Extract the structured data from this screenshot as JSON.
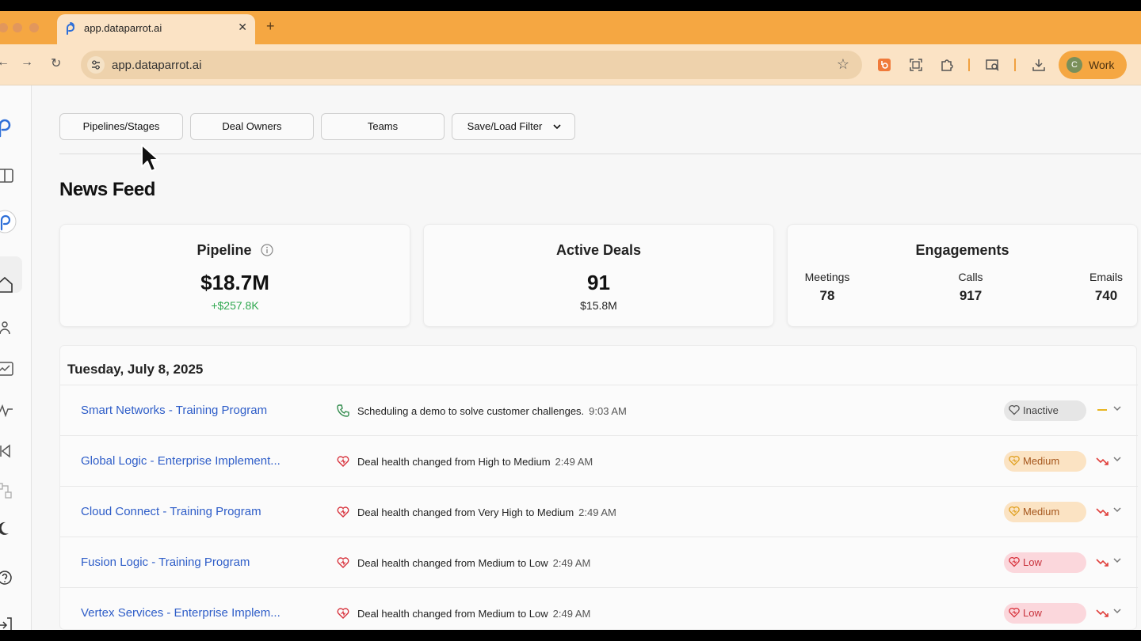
{
  "browser": {
    "tab_title": "app.dataparrot.ai",
    "close_glyph": "✕",
    "newtab_glyph": "+",
    "url": "app.dataparrot.ai",
    "profile_initial": "C",
    "profile_label": "Work",
    "back_glyph": "←",
    "forward_glyph": "→",
    "reload_glyph": "↻",
    "star_glyph": "☆"
  },
  "filters": {
    "pipelines": "Pipelines/Stages",
    "owners": "Deal Owners",
    "teams": "Teams",
    "save_load": "Save/Load Filter"
  },
  "page": {
    "title": "News Feed"
  },
  "cards": {
    "pipeline": {
      "title": "Pipeline",
      "value": "$18.7M",
      "change": "+$257.8K",
      "change_color": "#2fa84f"
    },
    "active_deals": {
      "title": "Active Deals",
      "value": "91",
      "amount": "$15.8M"
    },
    "engagements": {
      "title": "Engagements",
      "meetings_label": "Meetings",
      "meetings": "78",
      "calls_label": "Calls",
      "calls": "917",
      "emails_label": "Emails",
      "emails": "740"
    }
  },
  "feed": {
    "date": "Tuesday, July 8, 2025",
    "rows": [
      {
        "deal": "Smart Networks - Training Program",
        "icon": "phone-icon",
        "message": "Scheduling a demo to solve customer challenges.",
        "time": "9:03 AM",
        "health": "Inactive",
        "trend": "flat-icon"
      },
      {
        "deal": "Global Logic - Enterprise Implement...",
        "icon": "heart-pulse-icon",
        "message": "Deal health changed from High to Medium",
        "time": "2:49 AM",
        "health": "Medium",
        "trend": "trending-down-icon"
      },
      {
        "deal": "Cloud Connect - Training Program",
        "icon": "heart-pulse-icon",
        "message": "Deal health changed from Very High to Medium",
        "time": "2:49 AM",
        "health": "Medium",
        "trend": "trending-down-icon"
      },
      {
        "deal": "Fusion Logic - Training Program",
        "icon": "heart-pulse-icon",
        "message": "Deal health changed from Medium to Low",
        "time": "2:49 AM",
        "health": "Low",
        "trend": "trending-down-icon"
      },
      {
        "deal": "Vertex Services - Enterprise Implem...",
        "icon": "heart-pulse-icon",
        "message": "Deal health changed from Medium to Low",
        "time": "2:49 AM",
        "health": "Low",
        "trend": "trending-down-icon"
      }
    ]
  },
  "colors": {
    "link": "#2e5dc8",
    "accent_orange": "#f5a742",
    "inactive_bg": "#e6e6e6",
    "medium_bg": "#fbe3c3",
    "medium_fg": "#a5561c",
    "low_bg": "#fbd7dc",
    "low_fg": "#c8323c",
    "down_red": "#e0403c",
    "flat_yellow": "#e8b520"
  }
}
